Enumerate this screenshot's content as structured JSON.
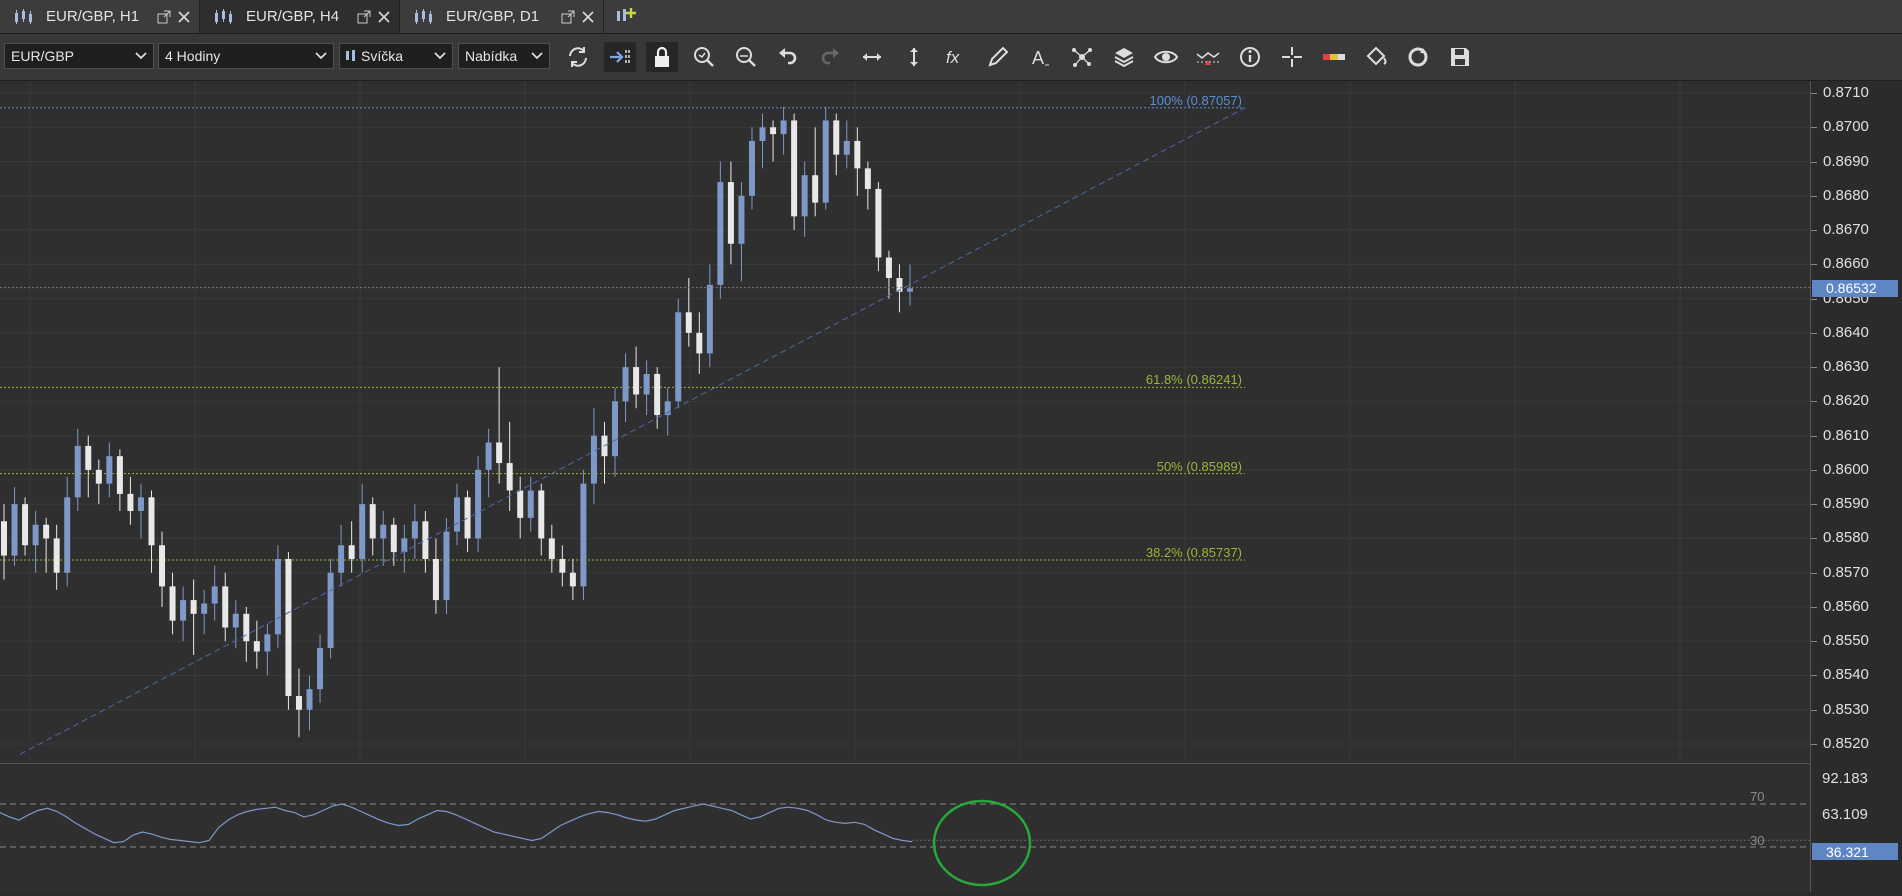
{
  "tabs": [
    {
      "label": "EUR/GBP, H1"
    },
    {
      "label": "EUR/GBP, H4",
      "active": true
    },
    {
      "label": "EUR/GBP, D1"
    }
  ],
  "toolbar": {
    "instrument": "EUR/GBP",
    "period": "4 Hodiny",
    "chart_type": "Svíčka",
    "price_side": "Nabídka",
    "tools": [
      "refresh-icon",
      "shift-chart-icon",
      "lock-icon",
      "zoom-in-icon",
      "zoom-out-icon",
      "undo-icon",
      "redo-icon",
      "horizontal-scale-icon",
      "vertical-scale-icon",
      "indicator-fx-icon",
      "pencil-icon",
      "text-icon",
      "pattern-icon",
      "layers-icon",
      "eye-icon",
      "alert-icon",
      "info-icon",
      "crosshair-icon",
      "color-bar-icon",
      "paint-bucket-icon",
      "cycle-icon",
      "save-icon"
    ]
  },
  "price_axis": {
    "ticks": [
      "0.8710",
      "0.8700",
      "0.8690",
      "0.8680",
      "0.8670",
      "0.8660",
      "0.8650",
      "0.8640",
      "0.8630",
      "0.8620",
      "0.8610",
      "0.8600",
      "0.8590",
      "0.8580",
      "0.8570",
      "0.8560",
      "0.8550",
      "0.8540",
      "0.8530",
      "0.8520"
    ],
    "current_price": "0.86532"
  },
  "fibonacci": [
    {
      "label": "100% (0.87057)",
      "price": 0.87057,
      "color": "#5b8fd6"
    },
    {
      "label": "61.8% (0.86241)",
      "price": 0.86241,
      "color": "#9ab53a"
    },
    {
      "label": "50% (0.85989)",
      "price": 0.85989,
      "color": "#9ab53a"
    },
    {
      "label": "38.2% (0.85737)",
      "price": 0.85737,
      "color": "#9ab53a"
    }
  ],
  "rsi": {
    "axis_ticks": [
      "92.183",
      "63.109"
    ],
    "level_high": "70",
    "level_low": "30",
    "current_value": "36.321",
    "values": [
      62,
      58,
      55,
      60,
      64,
      66,
      63,
      58,
      52,
      47,
      42,
      38,
      34,
      35,
      41,
      44,
      42,
      39,
      37,
      36,
      35,
      34,
      36,
      48,
      55,
      60,
      63,
      65,
      66,
      67,
      64,
      62,
      58,
      60,
      64,
      68,
      70,
      67,
      63,
      59,
      55,
      52,
      50,
      51,
      56,
      60,
      64,
      63,
      60,
      56,
      52,
      48,
      44,
      42,
      40,
      38,
      36,
      38,
      44,
      50,
      54,
      58,
      61,
      63,
      62,
      60,
      57,
      55,
      54,
      56,
      60,
      64,
      66,
      68,
      70,
      68,
      66,
      64,
      60,
      56,
      58,
      62,
      66,
      67,
      66,
      64,
      60,
      55,
      53,
      52,
      53,
      51,
      46,
      42,
      38,
      36,
      35
    ]
  },
  "chart_data": {
    "type": "candlestick",
    "instrument": "EUR/GBP",
    "timeframe": "H4",
    "ylim": [
      0.8515,
      0.8715
    ],
    "candles": [
      [
        0.8585,
        0.859,
        0.8568,
        0.8575
      ],
      [
        0.8575,
        0.8595,
        0.8572,
        0.859
      ],
      [
        0.859,
        0.8592,
        0.8575,
        0.8578
      ],
      [
        0.8578,
        0.8588,
        0.857,
        0.8584
      ],
      [
        0.8584,
        0.8586,
        0.857,
        0.858
      ],
      [
        0.858,
        0.8584,
        0.8565,
        0.857
      ],
      [
        0.857,
        0.8598,
        0.8566,
        0.8592
      ],
      [
        0.8592,
        0.8612,
        0.8588,
        0.8607
      ],
      [
        0.8607,
        0.861,
        0.8592,
        0.86
      ],
      [
        0.86,
        0.8603,
        0.859,
        0.8596
      ],
      [
        0.8596,
        0.8608,
        0.8592,
        0.8604
      ],
      [
        0.8604,
        0.8606,
        0.8588,
        0.8593
      ],
      [
        0.8593,
        0.8598,
        0.8584,
        0.8588
      ],
      [
        0.8588,
        0.8596,
        0.858,
        0.8592
      ],
      [
        0.8592,
        0.8594,
        0.857,
        0.8578
      ],
      [
        0.8578,
        0.8582,
        0.856,
        0.8566
      ],
      [
        0.8566,
        0.857,
        0.8552,
        0.8556
      ],
      [
        0.8556,
        0.8566,
        0.855,
        0.8562
      ],
      [
        0.8562,
        0.8568,
        0.8546,
        0.8558
      ],
      [
        0.8558,
        0.8565,
        0.8552,
        0.8561
      ],
      [
        0.8561,
        0.8572,
        0.8556,
        0.8566
      ],
      [
        0.8566,
        0.857,
        0.855,
        0.8554
      ],
      [
        0.8554,
        0.8562,
        0.8548,
        0.8558
      ],
      [
        0.8558,
        0.856,
        0.8544,
        0.855
      ],
      [
        0.855,
        0.8556,
        0.8542,
        0.8547
      ],
      [
        0.8547,
        0.8555,
        0.854,
        0.8552
      ],
      [
        0.8552,
        0.8578,
        0.8548,
        0.8574
      ],
      [
        0.8574,
        0.8576,
        0.853,
        0.8534
      ],
      [
        0.8534,
        0.8542,
        0.8522,
        0.853
      ],
      [
        0.853,
        0.854,
        0.8524,
        0.8536
      ],
      [
        0.8536,
        0.8552,
        0.8532,
        0.8548
      ],
      [
        0.8548,
        0.8574,
        0.8545,
        0.857
      ],
      [
        0.857,
        0.8584,
        0.8566,
        0.8578
      ],
      [
        0.8578,
        0.8585,
        0.857,
        0.8574
      ],
      [
        0.8574,
        0.8596,
        0.857,
        0.859
      ],
      [
        0.859,
        0.8592,
        0.8575,
        0.858
      ],
      [
        0.858,
        0.8588,
        0.8572,
        0.8584
      ],
      [
        0.8584,
        0.8586,
        0.8572,
        0.8576
      ],
      [
        0.8576,
        0.8584,
        0.857,
        0.858
      ],
      [
        0.858,
        0.859,
        0.8574,
        0.8585
      ],
      [
        0.8585,
        0.8588,
        0.857,
        0.8574
      ],
      [
        0.8574,
        0.858,
        0.8558,
        0.8562
      ],
      [
        0.8562,
        0.8586,
        0.8558,
        0.8582
      ],
      [
        0.8582,
        0.8596,
        0.8578,
        0.8592
      ],
      [
        0.8592,
        0.8594,
        0.8576,
        0.858
      ],
      [
        0.858,
        0.8604,
        0.8576,
        0.86
      ],
      [
        0.86,
        0.8612,
        0.8592,
        0.8608
      ],
      [
        0.8608,
        0.863,
        0.8596,
        0.8602
      ],
      [
        0.8602,
        0.8614,
        0.8588,
        0.8594
      ],
      [
        0.8594,
        0.8598,
        0.858,
        0.8586
      ],
      [
        0.8586,
        0.8598,
        0.8582,
        0.8594
      ],
      [
        0.8594,
        0.8596,
        0.8575,
        0.858
      ],
      [
        0.858,
        0.8584,
        0.857,
        0.8574
      ],
      [
        0.8574,
        0.8578,
        0.8566,
        0.857
      ],
      [
        0.857,
        0.8574,
        0.8562,
        0.8566
      ],
      [
        0.8566,
        0.86,
        0.8562,
        0.8596
      ],
      [
        0.8596,
        0.8618,
        0.859,
        0.861
      ],
      [
        0.861,
        0.8614,
        0.8596,
        0.8604
      ],
      [
        0.8604,
        0.8624,
        0.8598,
        0.862
      ],
      [
        0.862,
        0.8634,
        0.8614,
        0.863
      ],
      [
        0.863,
        0.8636,
        0.8618,
        0.8622
      ],
      [
        0.8622,
        0.8632,
        0.8616,
        0.8628
      ],
      [
        0.8628,
        0.863,
        0.8612,
        0.8616
      ],
      [
        0.8616,
        0.8624,
        0.861,
        0.862
      ],
      [
        0.862,
        0.865,
        0.8618,
        0.8646
      ],
      [
        0.8646,
        0.8656,
        0.8636,
        0.864
      ],
      [
        0.864,
        0.8646,
        0.8628,
        0.8634
      ],
      [
        0.8634,
        0.866,
        0.863,
        0.8654
      ],
      [
        0.8654,
        0.869,
        0.865,
        0.8684
      ],
      [
        0.8684,
        0.869,
        0.866,
        0.8666
      ],
      [
        0.8666,
        0.8684,
        0.8655,
        0.868
      ],
      [
        0.868,
        0.87,
        0.8676,
        0.8696
      ],
      [
        0.8696,
        0.8704,
        0.8688,
        0.87
      ],
      [
        0.87,
        0.8702,
        0.869,
        0.8698
      ],
      [
        0.8698,
        0.8706,
        0.8692,
        0.8702
      ],
      [
        0.8702,
        0.8704,
        0.867,
        0.8674
      ],
      [
        0.8674,
        0.869,
        0.8668,
        0.8686
      ],
      [
        0.8686,
        0.87,
        0.8674,
        0.8678
      ],
      [
        0.8678,
        0.8706,
        0.8676,
        0.8702
      ],
      [
        0.8702,
        0.8704,
        0.8686,
        0.8692
      ],
      [
        0.8692,
        0.8702,
        0.8688,
        0.8696
      ],
      [
        0.8696,
        0.87,
        0.868,
        0.8688
      ],
      [
        0.8688,
        0.869,
        0.8676,
        0.8682
      ],
      [
        0.8682,
        0.8684,
        0.8658,
        0.8662
      ],
      [
        0.8662,
        0.8664,
        0.865,
        0.8656
      ],
      [
        0.8656,
        0.866,
        0.8646,
        0.8652
      ],
      [
        0.8652,
        0.866,
        0.8648,
        0.8653
      ]
    ]
  }
}
